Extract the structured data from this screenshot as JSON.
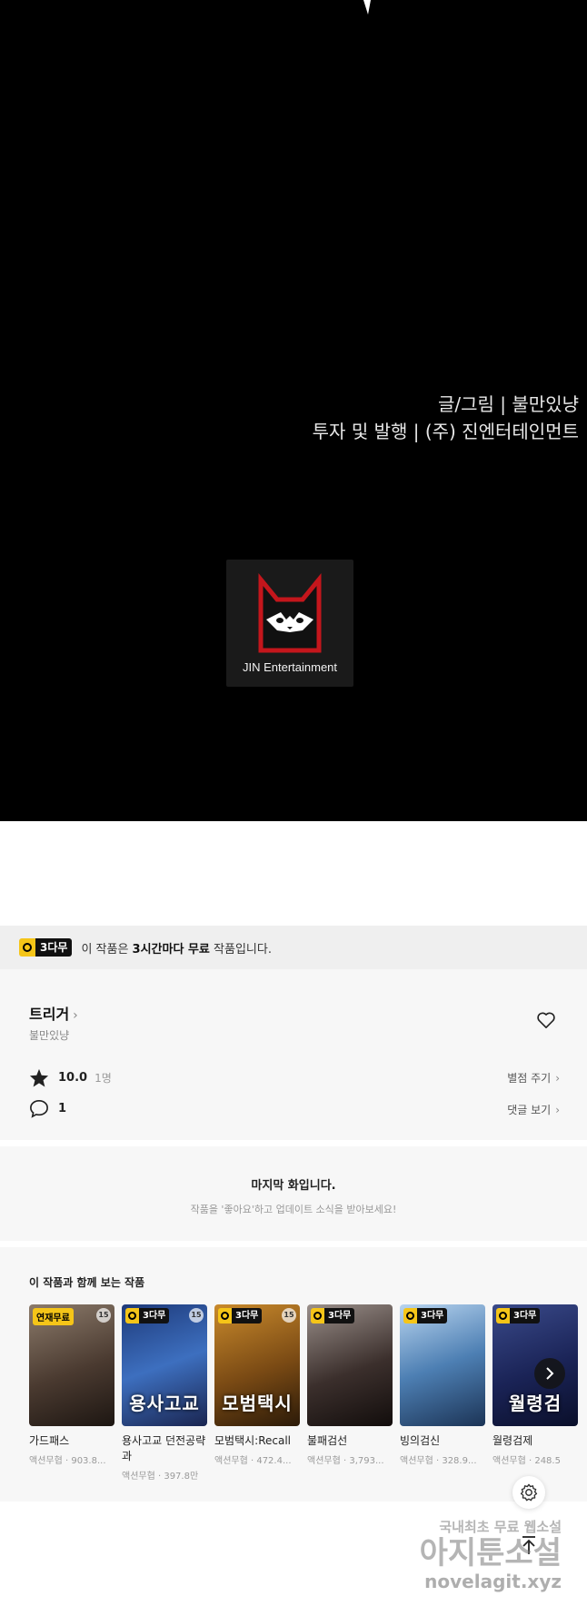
{
  "viewer": {
    "credit_line1": "글/그림 | 불만있냥",
    "credit_line2": "투자 및 발행 | (주) 진엔터테인먼트",
    "logo_text": "JIN Entertainment"
  },
  "free_bar": {
    "badge": "3다무",
    "text_before": "이 작품은 ",
    "text_bold": "3시간마다 무료",
    "text_after": " 작품입니다."
  },
  "info": {
    "title": "트리거",
    "author": "불만있냥",
    "rating": "10.0",
    "rating_count": "1명",
    "rate_action": "별점 주기",
    "comment_count": "1",
    "comment_action": "댓글 보기"
  },
  "last": {
    "heading": "마지막 화입니다.",
    "sub": "작품을 '좋아요'하고 업데이트 소식을 받아보세요!"
  },
  "recommend": {
    "title": "이 작품과 함께 보는 작품",
    "items": [
      {
        "badge": "연재무료",
        "age": "15",
        "name": "가드패스",
        "meta": "액션무협 · 903.8...",
        "bg": "#6d5a4a"
      },
      {
        "badge": "3다무",
        "age": "15",
        "name": "용사고교 던전공략과",
        "meta": "액션무협 · 397.8만",
        "bg": "#2a4f8f",
        "art": "용사고교"
      },
      {
        "badge": "3다무",
        "age": "15",
        "name": "모범택시:Recall",
        "meta": "액션무협 · 472.4...",
        "bg": "#8a5a1c",
        "art": "모범택시"
      },
      {
        "badge": "3다무",
        "age": "",
        "name": "불패검선",
        "meta": "액션무협 · 3,793...",
        "bg": "#5b4d4a"
      },
      {
        "badge": "3다무",
        "age": "",
        "name": "빙의검신",
        "meta": "액션무협 · 328.9...",
        "bg": "#3f6f9d"
      },
      {
        "badge": "3다무",
        "age": "",
        "name": "월령검제",
        "meta": "액션무협 · 248.5",
        "bg": "#1d2a5a",
        "art": "월령검"
      }
    ]
  },
  "watermark": {
    "line1": "국내최초 무료 웹소설",
    "line2": "아지툰소설",
    "line3": "novelagit.xyz"
  }
}
